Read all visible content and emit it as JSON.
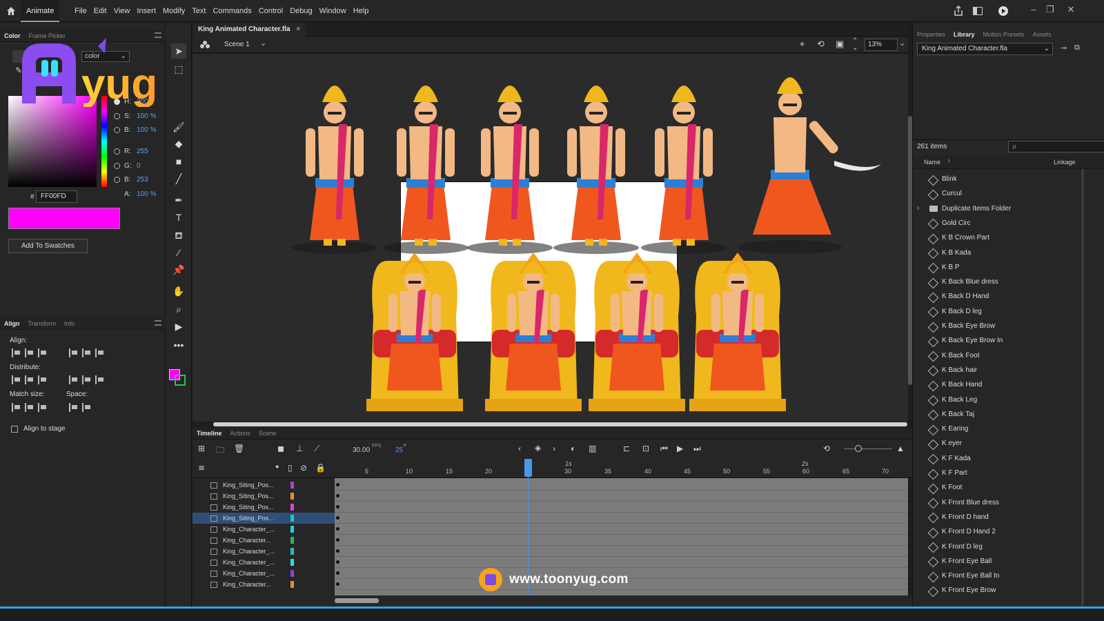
{
  "app": {
    "name": "Animate"
  },
  "menu": [
    "File",
    "Edit",
    "View",
    "Insert",
    "Modify",
    "Text",
    "Commands",
    "Control",
    "Debug",
    "Window",
    "Help"
  ],
  "color_panel": {
    "tabs": [
      "Color",
      "Frame Picker"
    ],
    "fill_type": "color",
    "hsb": [
      {
        "label": "H:",
        "value": "300 °"
      },
      {
        "label": "S:",
        "value": "100 %"
      },
      {
        "label": "B:",
        "value": "100 %"
      }
    ],
    "rgb": [
      {
        "label": "R:",
        "value": "255"
      },
      {
        "label": "G:",
        "value": "0"
      },
      {
        "label": "B:",
        "value": "253"
      }
    ],
    "alpha": {
      "label": "A:",
      "value": "100 %"
    },
    "hex_symbol": "#",
    "hex": "FF00FD",
    "add_swatches": "Add To Swatches",
    "swatch_color": "#ff00fd"
  },
  "align_panel": {
    "tabs": [
      "Align",
      "Transform",
      "Info"
    ],
    "align_label": "Align:",
    "distribute_label": "Distribute:",
    "match_size_label": "Match size:",
    "space_label": "Space:",
    "align_to_stage": "Align to stage"
  },
  "document": {
    "tab": "King Animated Character.fla",
    "scene": "Scene 1",
    "zoom": "13%"
  },
  "timeline": {
    "tabs": [
      "Timeline",
      "Actions",
      "Scene"
    ],
    "fps": "30.00",
    "fps_unit": "FPS",
    "frame": "25",
    "frame_unit": "F",
    "ruler": [
      "5",
      "10",
      "15",
      "20",
      "30",
      "35",
      "40",
      "45",
      "50",
      "55",
      "60",
      "65",
      "70"
    ],
    "seconds": [
      "1s",
      "2s"
    ],
    "layers": [
      {
        "name": "King_Siting_Pos...",
        "color": "#b03fd8"
      },
      {
        "name": "King_Siting_Pos...",
        "color": "#f08a2a"
      },
      {
        "name": "King_Siting_Pos...",
        "color": "#e040d8"
      },
      {
        "name": "King_Siting_Pos...",
        "color": "#20c8c0",
        "selected": true
      },
      {
        "name": "King_Character_...",
        "color": "#20d0e8"
      },
      {
        "name": "King_Character...",
        "color": "#30b060"
      },
      {
        "name": "King_Character_...",
        "color": "#20c0c0"
      },
      {
        "name": "King_Character_...",
        "color": "#20e0e8"
      },
      {
        "name": "King_Character_...",
        "color": "#9040d0"
      },
      {
        "name": "King_Character...",
        "color": "#f08a2a"
      }
    ]
  },
  "library": {
    "tabs": [
      "Properties",
      "Library",
      "Motion Presets",
      "Assets"
    ],
    "file": "King Animated Character.fla",
    "count": "261 items",
    "columns": {
      "name": "Name",
      "linkage": "Linkage"
    },
    "items": [
      "Blink",
      "Curcul",
      "Duplicate Items Folder",
      "Gold Circ",
      "K B Crown Part",
      "K B Kada",
      "K B P",
      "K Back Blue dress",
      "K Back D Hand",
      "K Back D leg",
      "K Back Eye Brow",
      "K Back Eye Brow In",
      "K Back Foot",
      "K Back hair",
      "K Back Hand",
      "K Back Leg",
      "K Back Taj",
      "K Earing",
      "K eyer",
      "K F Kada",
      "K F Part",
      "K Foot",
      "K Front Blue dress",
      "K Front D hand",
      "K Front D Hand 2",
      "K Front D leg",
      "K Front Eye Ball",
      "K Front Eye Ball In",
      "K Front Eye Brow"
    ]
  },
  "overlay": {
    "logo_text": "yug",
    "website": "www.toonyug.com"
  },
  "colors": {
    "accent": "#2aa7e5",
    "playhead": "#4a98e8",
    "selection": "#2f4f78"
  }
}
